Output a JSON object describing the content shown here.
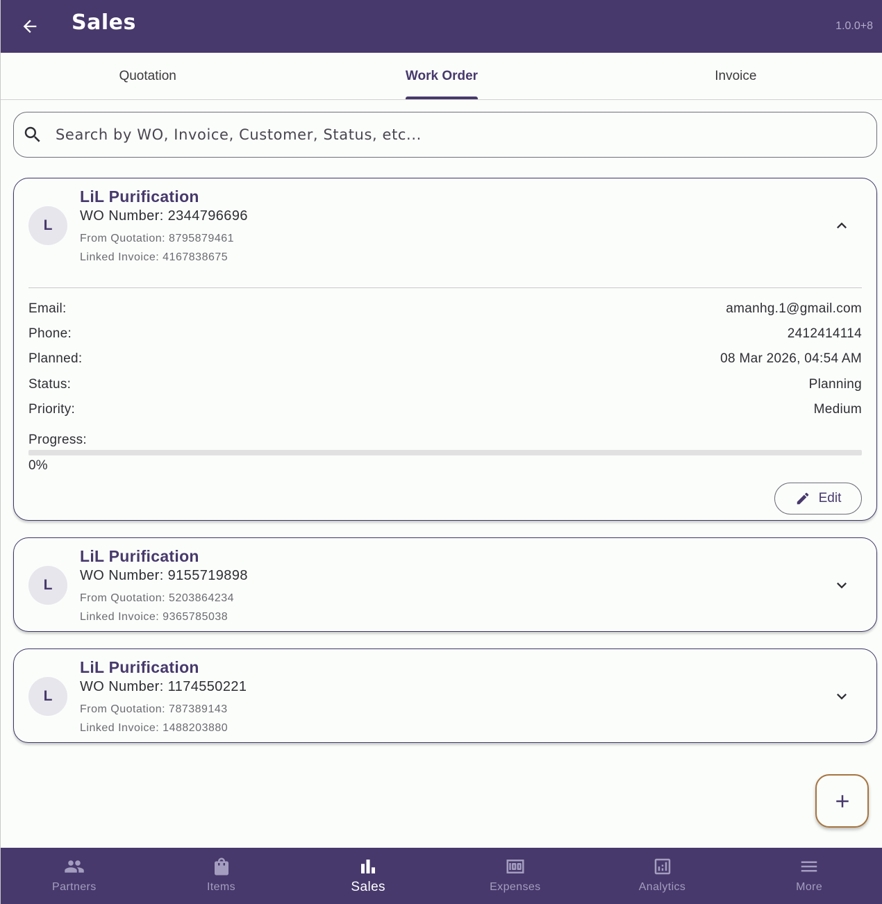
{
  "appbar": {
    "title": "Sales",
    "version": "1.0.0+8"
  },
  "tabs": [
    {
      "label": "Quotation"
    },
    {
      "label": "Work Order"
    },
    {
      "label": "Invoice"
    }
  ],
  "search": {
    "placeholder": "Search by WO, Invoice, Customer, Status, etc..."
  },
  "work_orders": [
    {
      "avatar": "L",
      "customer": "LiL Purification",
      "wo_number": "WO Number: 2344796696",
      "from_quotation": "From Quotation: 8795879461",
      "linked_invoice": "Linked Invoice: 4167838675",
      "expanded": true,
      "details": {
        "email_label": "Email:",
        "email": "amanhg.1@gmail.com",
        "phone_label": "Phone:",
        "phone": "2412414114",
        "planned_label": "Planned:",
        "planned": "08 Mar 2026, 04:54 AM",
        "status_label": "Status:",
        "status": "Planning",
        "priority_label": "Priority:",
        "priority": "Medium",
        "progress_label": "Progress:",
        "progress_value": 0,
        "progress_text": "0%"
      },
      "edit_label": "Edit"
    },
    {
      "avatar": "L",
      "customer": "LiL Purification",
      "wo_number": "WO Number: 9155719898",
      "from_quotation": "From Quotation: 5203864234",
      "linked_invoice": "Linked Invoice: 9365785038",
      "expanded": false
    },
    {
      "avatar": "L",
      "customer": "LiL Purification",
      "wo_number": "WO Number: 1174550221",
      "from_quotation": "From Quotation: 787389143",
      "linked_invoice": "Linked Invoice: 1488203880",
      "expanded": false
    }
  ],
  "bottom_nav": [
    {
      "label": "Partners",
      "icon": "people-icon"
    },
    {
      "label": "Items",
      "icon": "shopping-bag-icon"
    },
    {
      "label": "Sales",
      "icon": "bar-chart-icon",
      "active": true
    },
    {
      "label": "Expenses",
      "icon": "money-icon"
    },
    {
      "label": "Analytics",
      "icon": "analytics-icon"
    },
    {
      "label": "More",
      "icon": "menu-icon"
    }
  ],
  "colors": {
    "primary": "#47396c",
    "fab_border": "#a6753f",
    "background": "#fbfdfb"
  }
}
